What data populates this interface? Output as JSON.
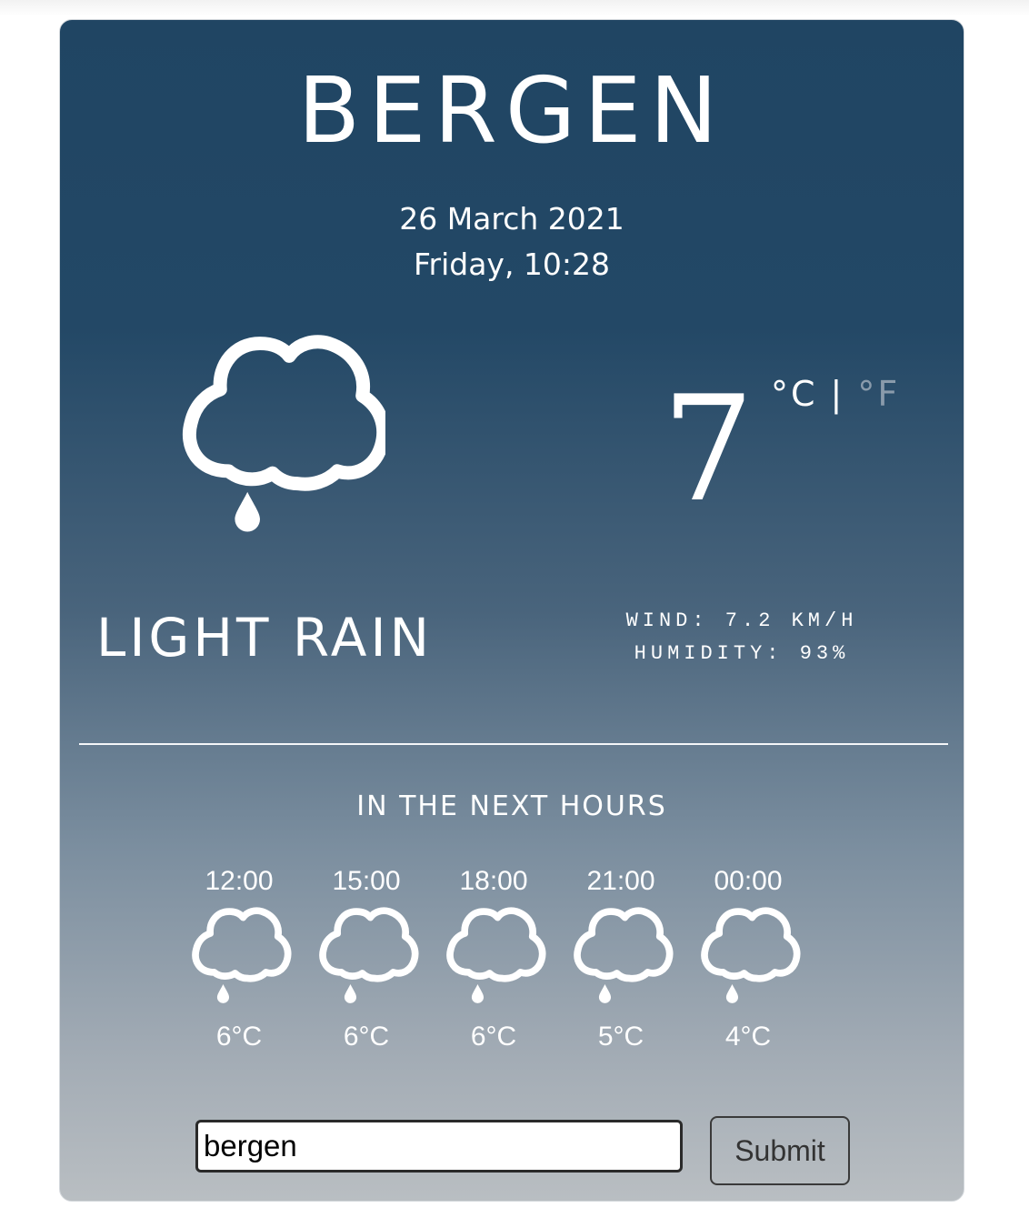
{
  "current": {
    "city": "BERGEN",
    "date": "26 March 2021",
    "day_time": "Friday, 10:28",
    "icon": "light-rain-icon",
    "temperature": "7",
    "unit_celsius": "°C",
    "unit_separator": "|",
    "unit_fahrenheit": "°F",
    "condition": "LIGHT RAIN",
    "wind": "WIND: 7.2 KM/H",
    "humidity": "HUMIDITY: 93%"
  },
  "forecast": {
    "title": "IN THE NEXT HOURS",
    "hours": [
      {
        "time": "12:00",
        "temp": "6°C",
        "icon": "light-rain-icon"
      },
      {
        "time": "15:00",
        "temp": "6°C",
        "icon": "light-rain-icon"
      },
      {
        "time": "18:00",
        "temp": "6°C",
        "icon": "light-rain-icon"
      },
      {
        "time": "21:00",
        "temp": "5°C",
        "icon": "light-rain-icon"
      },
      {
        "time": "00:00",
        "temp": "4°C",
        "icon": "light-rain-icon"
      }
    ]
  },
  "search": {
    "value": "bergen",
    "submit_label": "Submit"
  },
  "colors": {
    "gradient_top": "#204563",
    "gradient_bottom": "#b9bec2",
    "text": "#ffffff",
    "inactive_unit": "#8a9bab"
  }
}
